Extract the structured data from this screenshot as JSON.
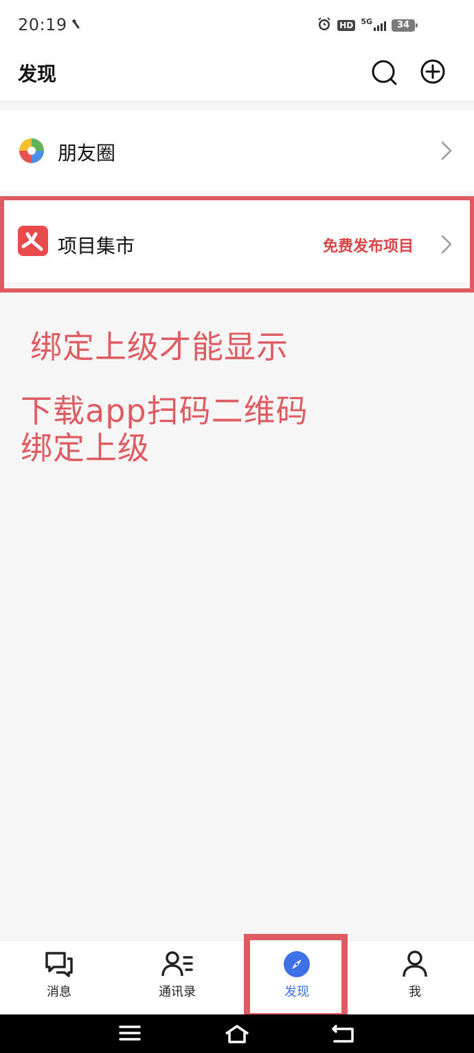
{
  "status_bar": {
    "time": "20:19",
    "hd": "HD",
    "network": "5G",
    "battery": "34"
  },
  "header": {
    "title": "发现"
  },
  "list": [
    {
      "label": "朋友圈",
      "extra": ""
    },
    {
      "label": "项目集市",
      "extra": "免费发布项目"
    }
  ],
  "annotations": {
    "note_1": "绑定上级才能显示",
    "note_2_line_1": "下载app扫码二维码",
    "note_2_line_2": "绑定上级"
  },
  "tab_bar": {
    "active": "发现",
    "tabs": [
      {
        "label": "消息"
      },
      {
        "label": "通讯录"
      },
      {
        "label": "发现"
      },
      {
        "label": "我"
      }
    ]
  },
  "colors": {
    "accent": "#3d6fe5",
    "annotation_red": "#df5b62",
    "promo_red": "#d94545"
  }
}
